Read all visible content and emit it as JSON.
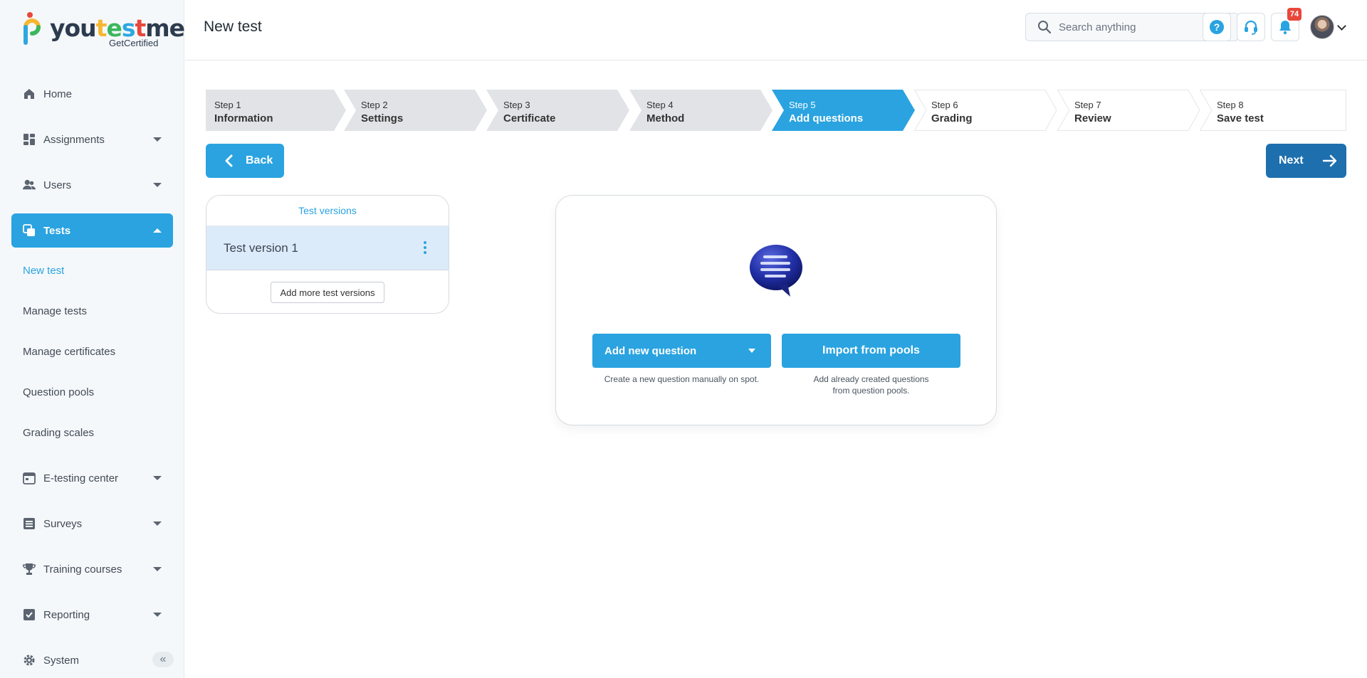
{
  "brand": {
    "logo_parts": [
      "you",
      "t",
      "e",
      "s",
      "t",
      "me"
    ],
    "tagline": "GetCertified"
  },
  "header": {
    "title": "New test",
    "search_placeholder": "Search anything",
    "notification_count": "74"
  },
  "sidebar": {
    "items": [
      {
        "label": "Home",
        "icon": "home-icon"
      },
      {
        "label": "Assignments",
        "icon": "dashboard-icon"
      },
      {
        "label": "Users",
        "icon": "users-icon"
      },
      {
        "label": "Tests",
        "icon": "copy-icon"
      },
      {
        "label": "E-testing center",
        "icon": "calendar-icon"
      },
      {
        "label": "Surveys",
        "icon": "list-icon"
      },
      {
        "label": "Training courses",
        "icon": "trophy-icon"
      },
      {
        "label": "Reporting",
        "icon": "checkbox-icon"
      },
      {
        "label": "System",
        "icon": "gear-icon"
      }
    ],
    "tests_subitems": [
      "New test",
      "Manage tests",
      "Manage certificates",
      "Question pools",
      "Grading scales"
    ]
  },
  "steps": [
    {
      "num": "Step 1",
      "name": "Information"
    },
    {
      "num": "Step 2",
      "name": "Settings"
    },
    {
      "num": "Step 3",
      "name": "Certificate"
    },
    {
      "num": "Step 4",
      "name": "Method"
    },
    {
      "num": "Step 5",
      "name": "Add questions"
    },
    {
      "num": "Step 6",
      "name": "Grading"
    },
    {
      "num": "Step 7",
      "name": "Review"
    },
    {
      "num": "Step 8",
      "name": "Save test"
    }
  ],
  "current_step": 5,
  "nav_buttons": {
    "back": "Back",
    "next": "Next"
  },
  "versions": {
    "title": "Test versions",
    "items": [
      "Test version 1"
    ],
    "add_label": "Add more test versions"
  },
  "questions": {
    "add_new_label": "Add new question",
    "add_new_hint": "Create a new question manually on spot.",
    "import_label": "Import from pools",
    "import_hint_1": "Add already created questions",
    "import_hint_2": "from question pools."
  },
  "colors": {
    "primary": "#2aa3e0",
    "next": "#1e6fae",
    "badge": "#e8473b",
    "completed_step": "#e1e3e6"
  }
}
